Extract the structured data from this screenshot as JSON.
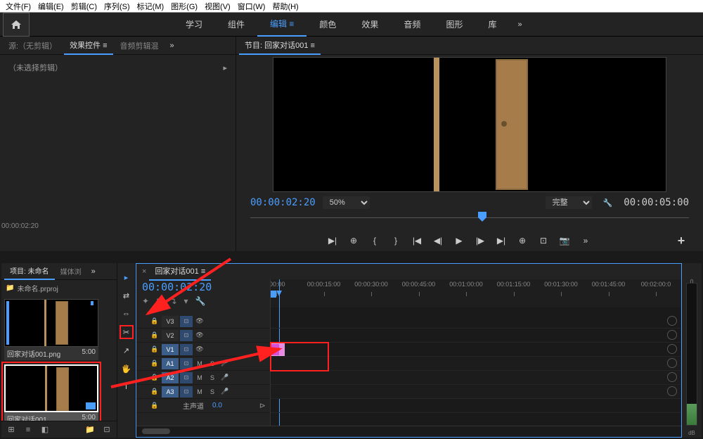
{
  "menu": [
    "文件(F)",
    "编辑(E)",
    "剪辑(C)",
    "序列(S)",
    "标记(M)",
    "图形(G)",
    "视图(V)",
    "窗口(W)",
    "帮助(H)"
  ],
  "workspaces": {
    "items": [
      "学习",
      "组件",
      "编辑",
      "颜色",
      "效果",
      "音频",
      "图形",
      "库"
    ],
    "active_index": 2
  },
  "source_panel": {
    "tabs": [
      "源:（无剪辑）",
      "效果控件",
      "音频剪辑混"
    ],
    "active_index": 1,
    "no_clip": "（未选择剪辑）",
    "tc": "00:00:02:20",
    "arrow": "▸"
  },
  "program_panel": {
    "title": "节目: 回家对话001",
    "tc_left": "00:00:02:20",
    "zoom": "50%",
    "quality": "完整",
    "tc_right": "00:00:05:00"
  },
  "transport_icons": [
    "▶|",
    "⊕",
    "{",
    "}",
    "|◀",
    "◀|",
    "▶",
    "|▶",
    "▶|",
    "⊕",
    "⊡",
    "📷",
    "»"
  ],
  "project_panel": {
    "tab1": "项目: 未命名",
    "tab2": "媒体浏",
    "folder_icon": "📁",
    "file": "未命名.prproj",
    "items": [
      {
        "name": "回家对话001.png",
        "dur": "5:00",
        "selected": false,
        "seq": false
      },
      {
        "name": "回家对话001",
        "dur": "5:00",
        "selected": true,
        "seq": true
      }
    ],
    "footer_icons": [
      "⊞",
      "≡",
      "◧",
      "📁",
      "⊡"
    ]
  },
  "tools": [
    "▸",
    "⇄",
    "⇔",
    "✂",
    "↗",
    "🖐",
    "T"
  ],
  "timeline": {
    "seq_name": "回家对话001",
    "tc": "00:00:02:20",
    "header_icons": [
      "✦",
      "⊓",
      "↴",
      "▾",
      "🔧"
    ],
    "ruler_marks": [
      ":00:00",
      "00:00:15:00",
      "00:00:30:00",
      "00:00:45:00",
      "00:01:00:00",
      "00:01:15:00",
      "00:01:30:00",
      "00:01:45:00",
      "00:02:00:0"
    ],
    "video_tracks": [
      "V3",
      "V2",
      "V1"
    ],
    "audio_tracks": [
      "A1",
      "A2",
      "A3"
    ],
    "master_label": "主声道",
    "master_val": "0.0",
    "mute": "M",
    "solo": "S",
    "lock": "🔒",
    "eye": "👁",
    "mic": "🎤",
    "fx": "⊡"
  },
  "meter": {
    "db": "dB",
    "zero": "0"
  }
}
